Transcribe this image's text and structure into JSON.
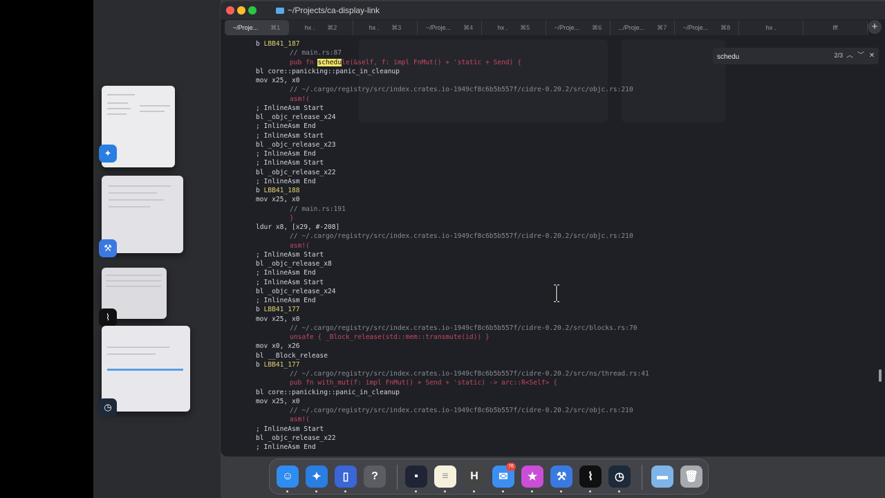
{
  "window": {
    "title": "~/Projects/ca-display-link"
  },
  "tabs": [
    {
      "label": "~/Proje...",
      "shortcut": "⌘1",
      "active": true
    },
    {
      "label": "hx .",
      "shortcut": "⌘2"
    },
    {
      "label": "hx .",
      "shortcut": "⌘3"
    },
    {
      "label": "~/Proje...",
      "shortcut": "⌘4"
    },
    {
      "label": "hx .",
      "shortcut": "⌘5"
    },
    {
      "label": "~/Proje...",
      "shortcut": "⌘6"
    },
    {
      "label": ".../Proje...",
      "shortcut": "⌘7"
    },
    {
      "label": "~/Proje...",
      "shortcut": "⌘8"
    },
    {
      "label": "hx .",
      "shortcut": ""
    },
    {
      "label": "lff",
      "shortcut": ""
    }
  ],
  "search": {
    "value": "schedu",
    "count": "2/3"
  },
  "code_lines": [
    {
      "indent": 0,
      "parts": [
        {
          "t": "b ",
          "c": ""
        },
        {
          "t": "LBB41_187",
          "c": "c-yellow"
        }
      ]
    },
    {
      "indent": 1,
      "parts": [
        {
          "t": "// main.rs:87",
          "c": "c-comment"
        }
      ]
    },
    {
      "indent": 1,
      "parts": [
        {
          "t": "pub fn ",
          "c": "c-red"
        },
        {
          "t": "schedu",
          "c": "hl"
        },
        {
          "t": "le(&self, f: impl FnMut() + 'static + Send) {",
          "c": "c-red"
        }
      ]
    },
    {
      "indent": 0,
      "parts": [
        {
          "t": "bl core::panicking::panic_in_cleanup",
          "c": ""
        }
      ]
    },
    {
      "indent": 0,
      "parts": [
        {
          "t": "mov x25, x0",
          "c": ""
        }
      ]
    },
    {
      "indent": 1,
      "parts": [
        {
          "t": "// ~/.cargo/registry/src/index.crates.io-1949cf8c6b5b557f/cidre-0.20.2/src/objc.rs:210",
          "c": "c-comment"
        }
      ]
    },
    {
      "indent": 1,
      "parts": [
        {
          "t": "asm!(",
          "c": "c-red"
        }
      ]
    },
    {
      "indent": 0,
      "parts": [
        {
          "t": "; InlineAsm Start",
          "c": ""
        }
      ]
    },
    {
      "indent": 0,
      "parts": [
        {
          "t": "bl _objc_release_x24",
          "c": ""
        }
      ]
    },
    {
      "indent": 0,
      "parts": [
        {
          "t": "; InlineAsm End",
          "c": ""
        }
      ]
    },
    {
      "indent": 0,
      "parts": [
        {
          "t": "; InlineAsm Start",
          "c": ""
        }
      ]
    },
    {
      "indent": 0,
      "parts": [
        {
          "t": "bl _objc_release_x23",
          "c": ""
        }
      ]
    },
    {
      "indent": 0,
      "parts": [
        {
          "t": "; InlineAsm End",
          "c": ""
        }
      ]
    },
    {
      "indent": 0,
      "parts": [
        {
          "t": "; InlineAsm Start",
          "c": ""
        }
      ]
    },
    {
      "indent": 0,
      "parts": [
        {
          "t": "bl _objc_release_x22",
          "c": ""
        }
      ]
    },
    {
      "indent": 0,
      "parts": [
        {
          "t": "; InlineAsm End",
          "c": ""
        }
      ]
    },
    {
      "indent": 0,
      "parts": [
        {
          "t": "b ",
          "c": ""
        },
        {
          "t": "LBB41_188",
          "c": "c-yellow"
        }
      ]
    },
    {
      "indent": 0,
      "parts": [
        {
          "t": "mov x25, x0",
          "c": ""
        }
      ]
    },
    {
      "indent": 1,
      "parts": [
        {
          "t": "// main.rs:191",
          "c": "c-comment"
        }
      ]
    },
    {
      "indent": 1,
      "parts": [
        {
          "t": "}",
          "c": "c-red"
        }
      ]
    },
    {
      "indent": 0,
      "parts": [
        {
          "t": "ldur x8, [x29, #-208]",
          "c": ""
        }
      ]
    },
    {
      "indent": 1,
      "parts": [
        {
          "t": "// ~/.cargo/registry/src/index.crates.io-1949cf8c6b5b557f/cidre-0.20.2/src/objc.rs:210",
          "c": "c-comment"
        }
      ]
    },
    {
      "indent": 1,
      "parts": [
        {
          "t": "asm!(",
          "c": "c-red"
        }
      ]
    },
    {
      "indent": 0,
      "parts": [
        {
          "t": "; InlineAsm Start",
          "c": ""
        }
      ]
    },
    {
      "indent": 0,
      "parts": [
        {
          "t": "bl _objc_release_x8",
          "c": ""
        }
      ]
    },
    {
      "indent": 0,
      "parts": [
        {
          "t": "; InlineAsm End",
          "c": ""
        }
      ]
    },
    {
      "indent": 0,
      "parts": [
        {
          "t": "; InlineAsm Start",
          "c": ""
        }
      ]
    },
    {
      "indent": 0,
      "parts": [
        {
          "t": "bl _objc_release_x24",
          "c": ""
        }
      ]
    },
    {
      "indent": 0,
      "parts": [
        {
          "t": "; InlineAsm End",
          "c": ""
        }
      ]
    },
    {
      "indent": 0,
      "parts": [
        {
          "t": "b ",
          "c": ""
        },
        {
          "t": "LBB41_177",
          "c": "c-yellow"
        }
      ]
    },
    {
      "indent": 0,
      "parts": [
        {
          "t": "mov x25, x0",
          "c": ""
        }
      ]
    },
    {
      "indent": 1,
      "parts": [
        {
          "t": "// ~/.cargo/registry/src/index.crates.io-1949cf8c6b5b557f/cidre-0.20.2/src/blocks.rs:70",
          "c": "c-comment"
        }
      ]
    },
    {
      "indent": 1,
      "parts": [
        {
          "t": "unsafe { _Block_release(std::mem::transmute(id)) }",
          "c": "c-red"
        }
      ]
    },
    {
      "indent": 0,
      "parts": [
        {
          "t": "mov x0, x26",
          "c": ""
        }
      ]
    },
    {
      "indent": 0,
      "parts": [
        {
          "t": "bl __Block_release",
          "c": ""
        }
      ]
    },
    {
      "indent": 0,
      "parts": [
        {
          "t": "b ",
          "c": ""
        },
        {
          "t": "LBB41_177",
          "c": "c-yellow"
        }
      ]
    },
    {
      "indent": 1,
      "parts": [
        {
          "t": "// ~/.cargo/registry/src/index.crates.io-1949cf8c6b5b557f/cidre-0.20.2/src/ns/thread.rs:41",
          "c": "c-comment"
        }
      ]
    },
    {
      "indent": 1,
      "parts": [
        {
          "t": "pub fn with_mut(f: impl FnMut() + Send + 'static) -> arc::R<Self> {",
          "c": "c-red"
        }
      ]
    },
    {
      "indent": 0,
      "parts": [
        {
          "t": "bl core::panicking::panic_in_cleanup",
          "c": ""
        }
      ]
    },
    {
      "indent": 0,
      "parts": [
        {
          "t": "mov x25, x0",
          "c": ""
        }
      ]
    },
    {
      "indent": 1,
      "parts": [
        {
          "t": "// ~/.cargo/registry/src/index.crates.io-1949cf8c6b5b557f/cidre-0.20.2/src/objc.rs:210",
          "c": "c-comment"
        }
      ]
    },
    {
      "indent": 1,
      "parts": [
        {
          "t": "asm!(",
          "c": "c-red"
        }
      ]
    },
    {
      "indent": 0,
      "parts": [
        {
          "t": "; InlineAsm Start",
          "c": ""
        }
      ]
    },
    {
      "indent": 0,
      "parts": [
        {
          "t": "bl _objc_release_x22",
          "c": ""
        }
      ]
    },
    {
      "indent": 0,
      "parts": [
        {
          "t": "; InlineAsm End",
          "c": ""
        }
      ]
    }
  ],
  "dock": {
    "mail_badge": "76",
    "apps": [
      {
        "name": "finder-app",
        "glyph": "☺",
        "color": "#2f8cf0"
      },
      {
        "name": "safari-app",
        "glyph": "✦",
        "color": "#2a7de1"
      },
      {
        "name": "simulator-app",
        "glyph": "▯",
        "color": "#3a66d6"
      },
      {
        "name": "help-app",
        "glyph": "?",
        "color": "#5b5d63"
      },
      {
        "name": "terminal-app",
        "glyph": "▪",
        "color": "#1f2436"
      },
      {
        "name": "notes-app",
        "glyph": "≡",
        "color": "#f5f1dc"
      },
      {
        "name": "helix-app",
        "glyph": "H",
        "color": "#444"
      },
      {
        "name": "mail-app",
        "glyph": "✉",
        "color": "#3c8ff0"
      },
      {
        "name": "feedback-app",
        "glyph": "★",
        "color": "#c94fd6"
      },
      {
        "name": "xcode-beta-app",
        "glyph": "⚒",
        "color": "#3a7ae0"
      },
      {
        "name": "activity-monitor-app",
        "glyph": "⌇",
        "color": "#101010"
      },
      {
        "name": "instruments-app",
        "glyph": "◷",
        "color": "#1d2a3a"
      },
      {
        "name": "downloads-folder",
        "glyph": "▬",
        "color": "#7fb4e8"
      },
      {
        "name": "trash",
        "glyph": "🗑",
        "color": "#a8aab0"
      }
    ]
  }
}
